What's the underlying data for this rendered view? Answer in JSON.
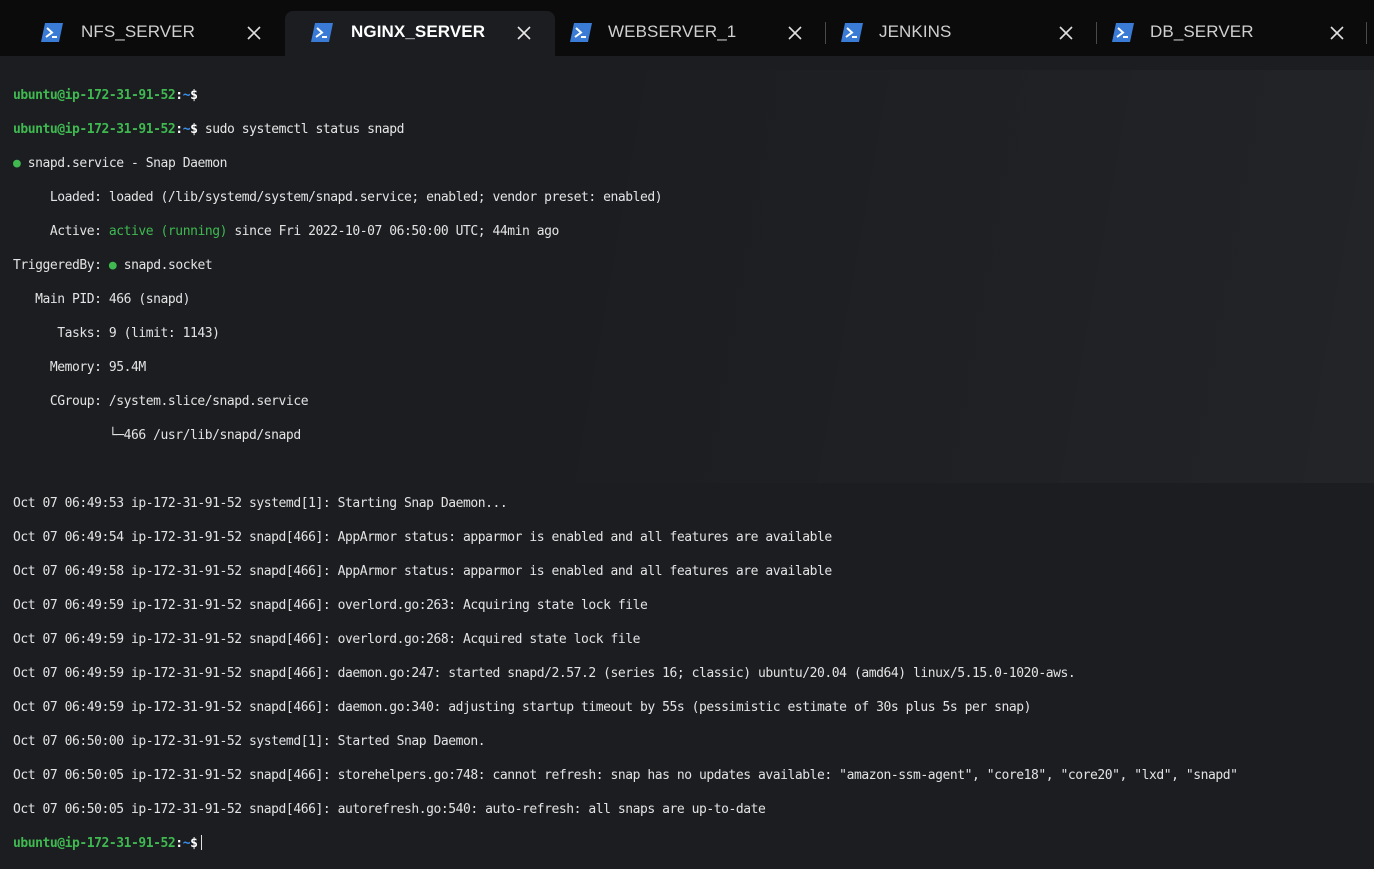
{
  "tabs": [
    {
      "title": "NFS_SERVER",
      "active": false
    },
    {
      "title": "NGINX_SERVER",
      "active": true
    },
    {
      "title": "WEBSERVER_1",
      "active": false
    },
    {
      "title": "JENKINS",
      "active": false
    },
    {
      "title": "DB_SERVER",
      "active": false
    }
  ],
  "colors": {
    "prompt_user": "#3fb950",
    "prompt_path": "#3b8eea",
    "tab_icon": "#3a7bd5"
  },
  "terminal": {
    "prompt_user": "ubuntu@ip-172-31-91-52",
    "prompt_path": "~",
    "prompt_symbol": "$",
    "command": "sudo systemctl status snapd",
    "service_line": "snapd.service - Snap Daemon",
    "bullet": "●",
    "loaded_label": "     Loaded:",
    "loaded_value": "loaded (/lib/systemd/system/snapd.service; enabled; vendor preset: enabled)",
    "active_label": "     Active:",
    "active_state": "active (running)",
    "active_since": "since Fri 2022-10-07 06:50:00 UTC; 44min ago",
    "triggered_label": "TriggeredBy:",
    "triggered_value": "snapd.socket",
    "details": [
      "   Main PID: 466 (snapd)",
      "      Tasks: 9 (limit: 1143)",
      "     Memory: 95.4M",
      "     CGroup: /system.slice/snapd.service",
      "             └─466 /usr/lib/snapd/snapd"
    ],
    "log_lines": [
      "Oct 07 06:49:53 ip-172-31-91-52 systemd[1]: Starting Snap Daemon...",
      "Oct 07 06:49:54 ip-172-31-91-52 snapd[466]: AppArmor status: apparmor is enabled and all features are available",
      "Oct 07 06:49:58 ip-172-31-91-52 snapd[466]: AppArmor status: apparmor is enabled and all features are available",
      "Oct 07 06:49:59 ip-172-31-91-52 snapd[466]: overlord.go:263: Acquiring state lock file",
      "Oct 07 06:49:59 ip-172-31-91-52 snapd[466]: overlord.go:268: Acquired state lock file",
      "Oct 07 06:49:59 ip-172-31-91-52 snapd[466]: daemon.go:247: started snapd/2.57.2 (series 16; classic) ubuntu/20.04 (amd64) linux/5.15.0-1020-aws.",
      "Oct 07 06:49:59 ip-172-31-91-52 snapd[466]: daemon.go:340: adjusting startup timeout by 55s (pessimistic estimate of 30s plus 5s per snap)",
      "Oct 07 06:50:00 ip-172-31-91-52 systemd[1]: Started Snap Daemon.",
      "Oct 07 06:50:05 ip-172-31-91-52 snapd[466]: storehelpers.go:748: cannot refresh: snap has no updates available: \"amazon-ssm-agent\", \"core18\", \"core20\", \"lxd\", \"snapd\"",
      "Oct 07 06:50:05 ip-172-31-91-52 snapd[466]: autorefresh.go:540: auto-refresh: all snaps are up-to-date"
    ]
  }
}
